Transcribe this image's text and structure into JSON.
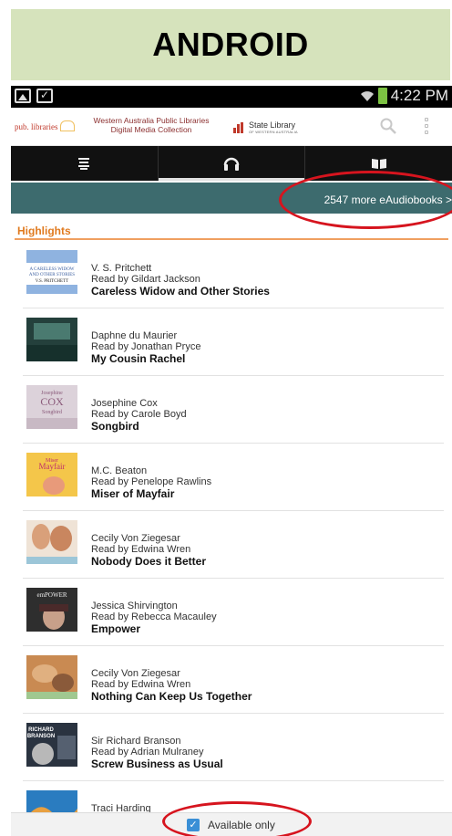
{
  "banner": {
    "title": "ANDROID"
  },
  "statusbar": {
    "time": "4:22 PM"
  },
  "header": {
    "public_logo": "pub. libraries",
    "wapl_line1": "Western Australia Public Libraries",
    "wapl_line2": "Digital Media Collection",
    "state_library": "State Library",
    "state_library_sub": "OF WESTERN AUSTRALIA"
  },
  "tabs": [
    {
      "icon": "list-icon",
      "active": false
    },
    {
      "icon": "headphones-icon",
      "active": true
    },
    {
      "icon": "book-icon",
      "active": false
    }
  ],
  "more_link": "2547 more eAudiobooks >",
  "highlights_title": "Highlights",
  "books": [
    {
      "author": "V. S. Pritchett",
      "reader": "Read by Gildart Jackson",
      "title": "Careless Widow and Other Stories",
      "cover_color": "#7fa8d8",
      "cover_text": "A CARELESS WIDOW AND OTHER STORIES V.S. PRITCHETT"
    },
    {
      "author": "Daphne du Maurier",
      "reader": "Read by Jonathan Pryce",
      "title": "My Cousin Rachel",
      "cover_color": "#2c4a45",
      "cover_text": ""
    },
    {
      "author": "Josephine Cox",
      "reader": "Read by Carole Boyd",
      "title": "Songbird",
      "cover_color": "#d8cdd6",
      "cover_text": "Josephine COX Songbird"
    },
    {
      "author": "M.C. Beaton",
      "reader": "Read by Penelope Rawlins",
      "title": "Miser of Mayfair",
      "cover_color": "#f2c23e",
      "cover_text": "Miser Mayfair"
    },
    {
      "author": "Cecily Von Ziegesar",
      "reader": "Read by Edwina Wren",
      "title": "Nobody Does it Better",
      "cover_color": "#e9d9c8",
      "cover_text": ""
    },
    {
      "author": "Jessica Shirvington",
      "reader": "Read by Rebecca Macauley",
      "title": "Empower",
      "cover_color": "#3a3a3a",
      "cover_text": "emPOWER"
    },
    {
      "author": "Cecily Von Ziegesar",
      "reader": "Read by Edwina Wren",
      "title": "Nothing Can Keep Us Together",
      "cover_color": "#c9834a",
      "cover_text": ""
    },
    {
      "author": "Sir Richard Branson",
      "reader": "Read by Adrian Mulraney",
      "title": "Screw Business as Usual",
      "cover_color": "#2a3340",
      "cover_text": "RICHARD BRANSON"
    },
    {
      "author": "Traci Harding",
      "reader": "",
      "title": "",
      "cover_color": "#2a7cc0",
      "cover_text": ""
    }
  ],
  "bottom": {
    "available_only": "Available only",
    "checked": true
  },
  "colors": {
    "banner": "#d6e3bc",
    "teal_bar": "#3d6b6e",
    "highlight_accent": "#e07a1f",
    "annotation_red": "#d6141e",
    "checkbox_blue": "#3a8fd6"
  }
}
